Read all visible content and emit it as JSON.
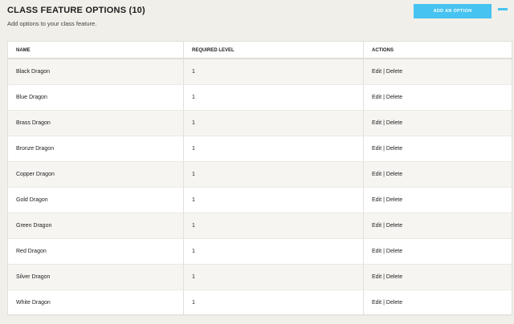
{
  "header": {
    "title": "CLASS FEATURE OPTIONS (10)",
    "subtitle": "Add options to your class feature.",
    "add_button_label": "ADD AN OPTION"
  },
  "colors": {
    "accent": "#46c3f0",
    "background": "#f1efe9",
    "row_alt": "#f6f5f2"
  },
  "table": {
    "columns": [
      "NAME",
      "REQUIRED LEVEL",
      "ACTIONS"
    ],
    "actions": {
      "edit": "Edit",
      "separator": "|",
      "delete": "Delete"
    },
    "rows": [
      {
        "name": "Black Dragon",
        "level": "1"
      },
      {
        "name": "Blue Dragon",
        "level": "1"
      },
      {
        "name": "Brass Dragon",
        "level": "1"
      },
      {
        "name": "Bronze Dragon",
        "level": "1"
      },
      {
        "name": "Copper Dragon",
        "level": "1"
      },
      {
        "name": "Gold Dragon",
        "level": "1"
      },
      {
        "name": "Green Dragon",
        "level": "1"
      },
      {
        "name": "Red Dragon",
        "level": "1"
      },
      {
        "name": "Silver Dragon",
        "level": "1"
      },
      {
        "name": "White Dragon",
        "level": "1"
      }
    ]
  }
}
